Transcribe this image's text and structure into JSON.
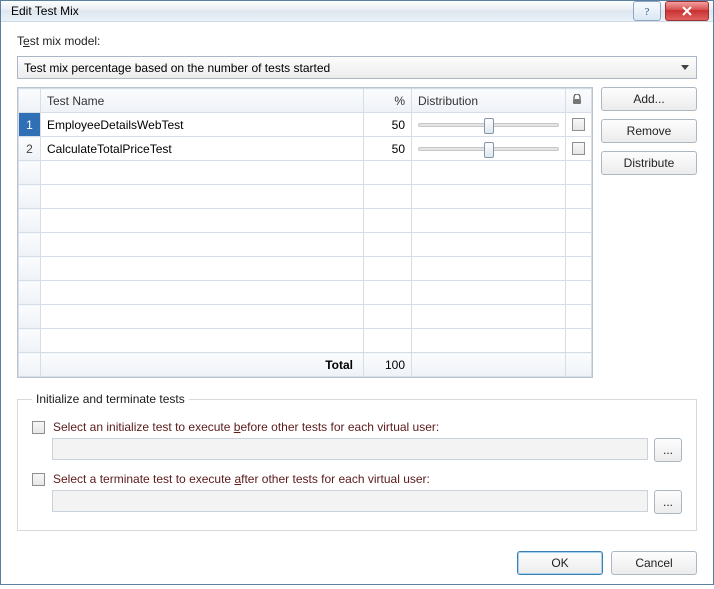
{
  "window": {
    "title": "Edit Test Mix"
  },
  "model": {
    "label_pre": "T",
    "label_u": "e",
    "label_post": "st mix model:",
    "value": "Test mix percentage based on the number of tests started"
  },
  "table": {
    "headers": {
      "name": "Test Name",
      "pct": "%",
      "dist": "Distribution"
    },
    "rows": [
      {
        "idx": "1",
        "name": "EmployeeDetailsWebTest",
        "pct": "50"
      },
      {
        "idx": "2",
        "name": "CalculateTotalPriceTest",
        "pct": "50"
      }
    ],
    "total_label": "Total",
    "total_value": "100"
  },
  "buttons": {
    "add": "Add...",
    "remove": "Remove",
    "distribute": "Distribute",
    "ok": "OK",
    "cancel": "Cancel",
    "browse": "..."
  },
  "init_term": {
    "legend": "Initialize and terminate tests",
    "init_pre": "Select an initialize test to execute ",
    "init_u": "b",
    "init_post": "efore other tests for each virtual user:",
    "term_pre": "Select a terminate test to execute ",
    "term_u": "a",
    "term_post": "fter other tests for each virtual user:"
  }
}
